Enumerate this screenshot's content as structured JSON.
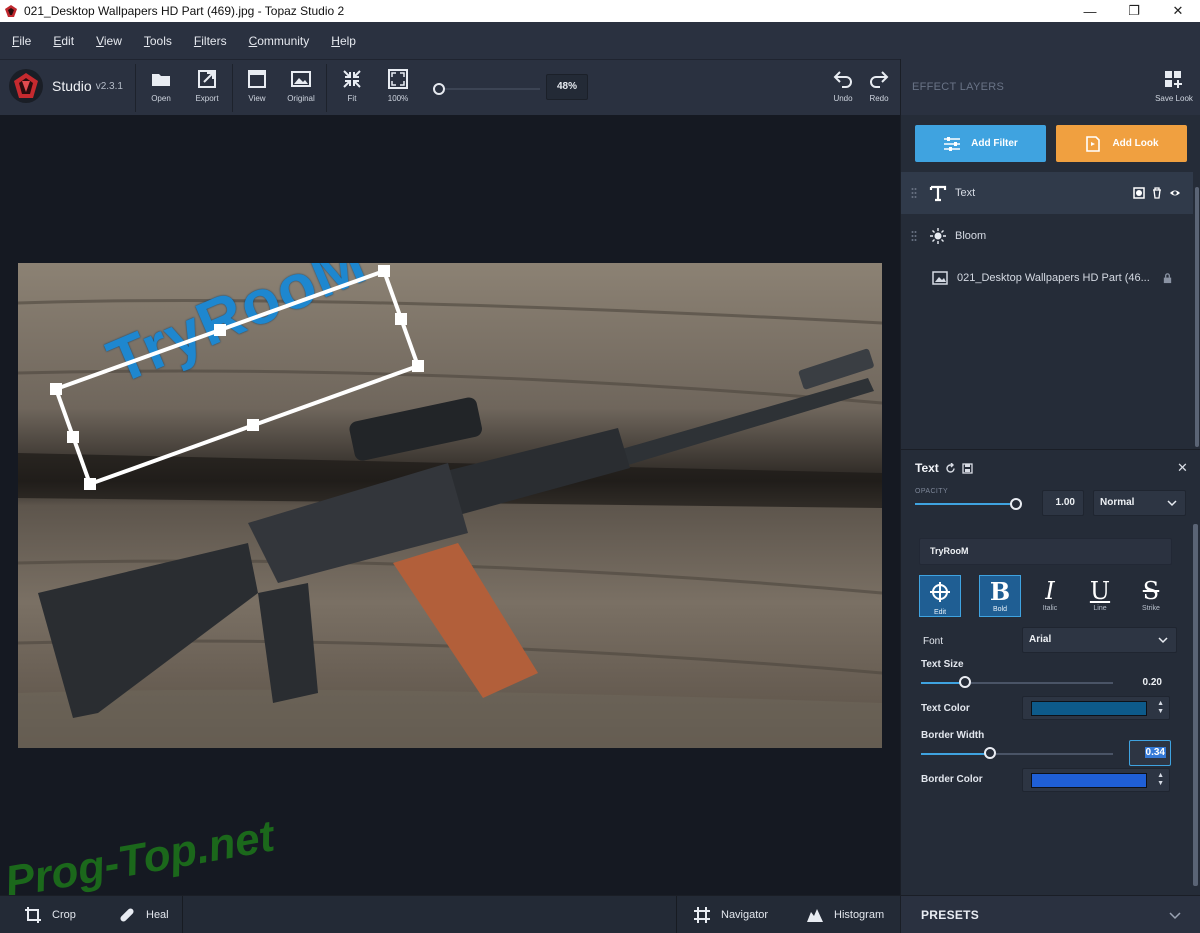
{
  "window": {
    "title": "021_Desktop Wallpapers  HD Part (469).jpg - Topaz Studio 2",
    "minimize": "—",
    "maximize": "❐",
    "close": "✕"
  },
  "menu": {
    "items": [
      {
        "first": "F",
        "rest": "ile"
      },
      {
        "first": "E",
        "rest": "dit"
      },
      {
        "first": "V",
        "rest": "iew"
      },
      {
        "first": "T",
        "rest": "ools"
      },
      {
        "first": "F",
        "rest": "ilters"
      },
      {
        "first": "C",
        "rest": "ommunity"
      },
      {
        "first": "H",
        "rest": "elp"
      }
    ]
  },
  "brand": {
    "name": "Studio",
    "version": "v2.3.1"
  },
  "toolbar": {
    "open": "Open",
    "export": "Export",
    "view": "View",
    "original": "Original",
    "fit": "Fit",
    "hundred": "100%",
    "zoom": "48%",
    "undo": "Undo",
    "redo": "Redo"
  },
  "canvas": {
    "overlay_text": "TryRooM",
    "watermark": "Prog-Top.net"
  },
  "bottom": {
    "crop": "Crop",
    "heal": "Heal",
    "navigator": "Navigator",
    "histogram": "Histogram"
  },
  "effects": {
    "title": "EFFECT LAYERS",
    "save_look": "Save Look",
    "add_filter": "Add Filter",
    "add_look": "Add Look",
    "layers": [
      {
        "name": "Text",
        "icon": "text-icon"
      },
      {
        "name": "Bloom",
        "icon": "bloom-icon"
      },
      {
        "name": "021_Desktop Wallpapers  HD Part (46...",
        "icon": "image-icon"
      }
    ]
  },
  "text_panel": {
    "title": "Text",
    "opacity_label": "OPACITY",
    "opacity_value": "1.00",
    "opacity_fraction": 1.0,
    "blend_mode": "Normal",
    "text_value": "TryRooM",
    "format_buttons": [
      {
        "label": "Edit",
        "active": true
      },
      {
        "label": "Bold",
        "active": true
      },
      {
        "label": "Italic",
        "active": false
      },
      {
        "label": "Line",
        "active": false
      },
      {
        "label": "Strike",
        "active": false
      }
    ],
    "font_label": "Font",
    "font_value": "Arial",
    "text_size_label": "Text Size",
    "text_size_value": "0.20",
    "text_color_label": "Text Color",
    "text_color": "#0d5a8a",
    "border_width_label": "Border Width",
    "border_width_value": "0.34",
    "border_color_label": "Border Color",
    "border_color": "#1f5fd6"
  },
  "presets": {
    "title": "PRESETS"
  }
}
